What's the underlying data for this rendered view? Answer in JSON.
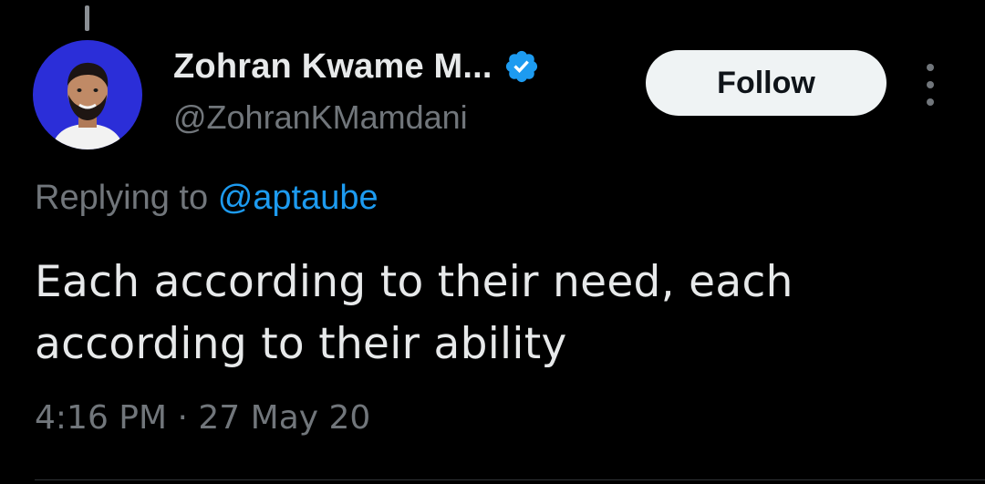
{
  "author": {
    "display_name": "Zohran Kwame M...",
    "handle": "@ZohranKMamdani",
    "verified_icon": "verified-badge-icon",
    "avatar_bg": "#2b2ed8"
  },
  "actions": {
    "follow_label": "Follow",
    "more_icon": "more-vertical-icon"
  },
  "reply": {
    "prefix": "Replying to",
    "to_handle": "@aptaube"
  },
  "tweet": {
    "text": "Each according to their need, each according to their ability",
    "timestamp": "4:16 PM · 27 May 20"
  },
  "colors": {
    "background": "#000000",
    "primary_text": "#e7e9ea",
    "secondary_text": "#71767b",
    "link": "#1d9bf0",
    "follow_button_bg": "#eff3f4"
  }
}
